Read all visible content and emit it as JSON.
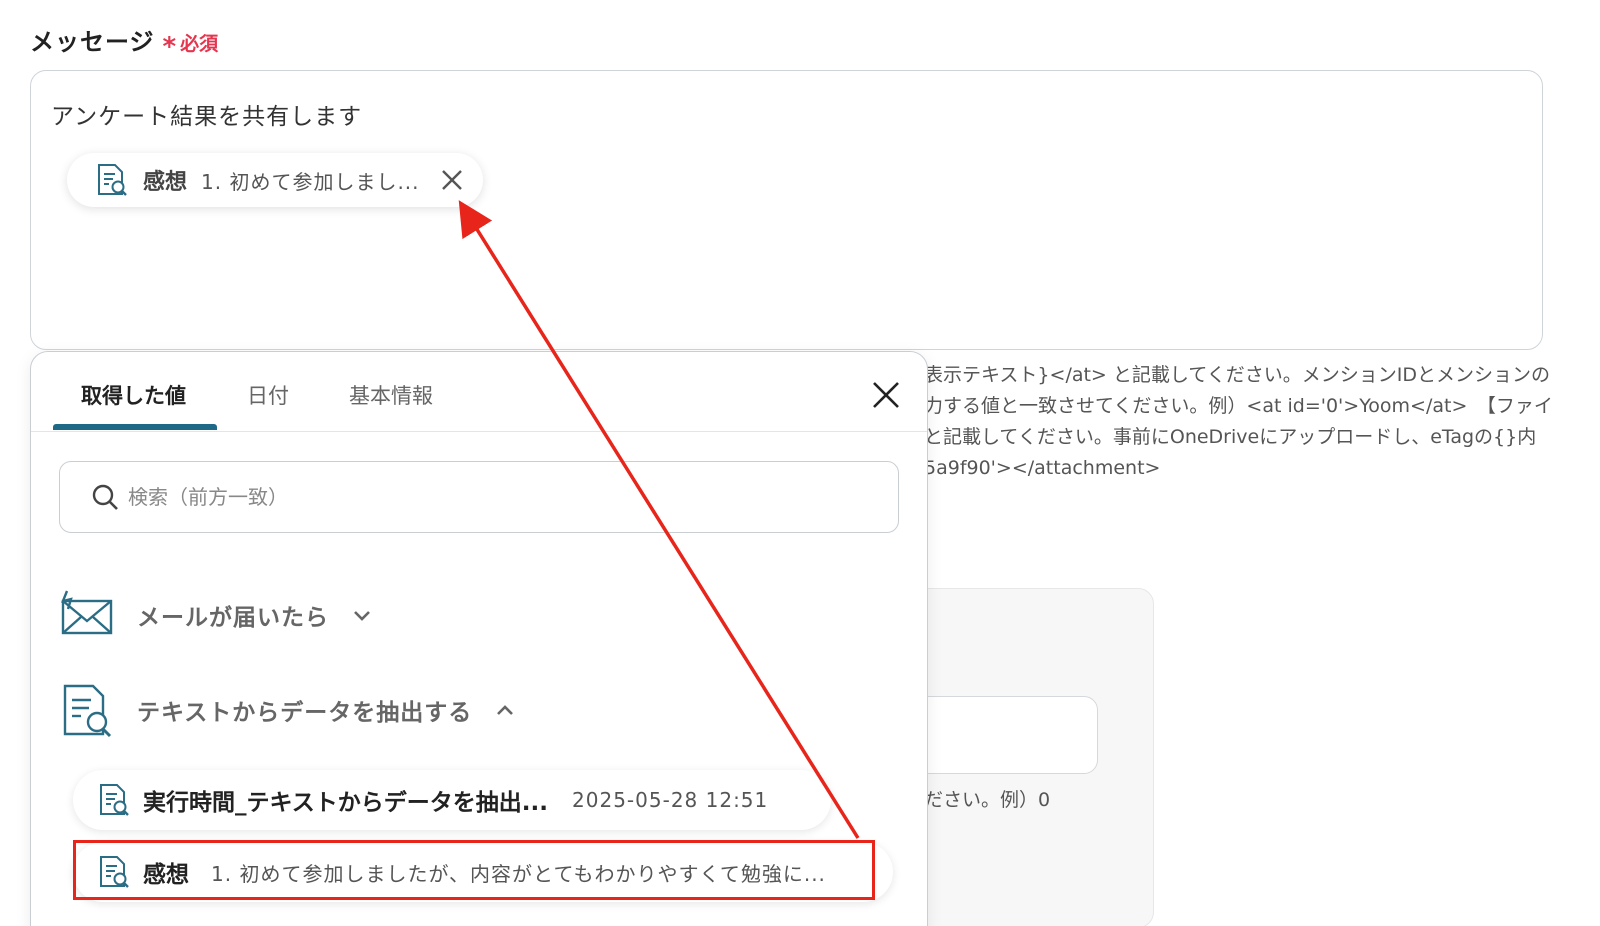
{
  "field": {
    "label": "メッセージ",
    "required_star": "*",
    "required_text": "必須",
    "value": "アンケート結果を共有します",
    "chip": {
      "title": "感想",
      "value": "1. 初めて参加しまし..."
    }
  },
  "help_lines": [
    "表示テキスト}</at> と記載してください。メンションIDとメンションの",
    "力する値と一致させてください。例）<at id='0'>Yoom</at>　【ファイ",
    "と記載してください。事前にOneDriveにアップロードし、eTagの{}内",
    "5a9f90'></attachment>"
  ],
  "background_hint": "ださい。例）0",
  "panel": {
    "tabs": [
      "取得した値",
      "日付",
      "基本情報"
    ],
    "active_tab": 0,
    "search_placeholder": "検索（前方一致）",
    "sections": [
      {
        "title": "メールが届いたら",
        "expanded": false,
        "icon": "mail-icon"
      },
      {
        "title": "テキストからデータを抽出する",
        "expanded": true,
        "icon": "document-search-icon"
      }
    ],
    "items": [
      {
        "title": "実行時間_テキストからデータを抽出...",
        "date": "2025-05-28 12:51"
      },
      {
        "title": "感想",
        "value": "1. 初めて参加しましたが、内容がとてもわかりやすくて勉強に..."
      }
    ]
  },
  "colors": {
    "accent": "#1e6a86",
    "required": "#e5364f",
    "annotation": "#e8251b"
  }
}
